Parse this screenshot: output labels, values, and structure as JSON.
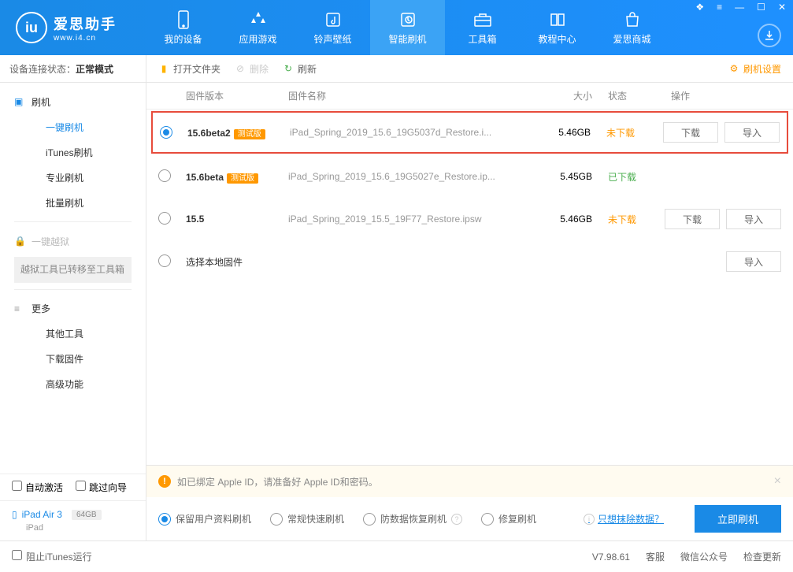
{
  "logo": {
    "cn": "爱思助手",
    "en": "www.i4.cn"
  },
  "nav": [
    {
      "label": "我的设备"
    },
    {
      "label": "应用游戏"
    },
    {
      "label": "铃声壁纸"
    },
    {
      "label": "智能刷机"
    },
    {
      "label": "工具箱"
    },
    {
      "label": "教程中心"
    },
    {
      "label": "爱思商城"
    }
  ],
  "status": {
    "label": "设备连接状态：",
    "value": "正常模式"
  },
  "sidebar": {
    "flash_group": "刷机",
    "items": [
      "一键刷机",
      "iTunes刷机",
      "专业刷机",
      "批量刷机"
    ],
    "jailbreak": "一键越狱",
    "jailbreak_note": "越狱工具已转移至工具箱",
    "more": "更多",
    "more_items": [
      "其他工具",
      "下载固件",
      "高级功能"
    ]
  },
  "checkboxes": {
    "auto_activate": "自动激活",
    "skip_guide": "跳过向导"
  },
  "device": {
    "name": "iPad Air 3",
    "storage": "64GB",
    "type": "iPad"
  },
  "toolbar": {
    "open": "打开文件夹",
    "delete": "删除",
    "refresh": "刷新",
    "settings": "刷机设置"
  },
  "table": {
    "headers": {
      "version": "固件版本",
      "name": "固件名称",
      "size": "大小",
      "status": "状态",
      "ops": "操作"
    },
    "rows": [
      {
        "selected": true,
        "highlighted": true,
        "version": "15.6beta2",
        "beta": "测试版",
        "name": "iPad_Spring_2019_15.6_19G5037d_Restore.i...",
        "size": "5.46GB",
        "status": "未下载",
        "status_cls": "not",
        "ops": true
      },
      {
        "selected": false,
        "version": "15.6beta",
        "beta": "测试版",
        "name": "iPad_Spring_2019_15.6_19G5027e_Restore.ip...",
        "size": "5.45GB",
        "status": "已下载",
        "status_cls": "done",
        "ops": false
      },
      {
        "selected": false,
        "version": "15.5",
        "beta": "",
        "name": "iPad_Spring_2019_15.5_19F77_Restore.ipsw",
        "size": "5.46GB",
        "status": "未下载",
        "status_cls": "not",
        "ops": true
      },
      {
        "selected": false,
        "version": "",
        "beta": "",
        "name_direct": "选择本地固件",
        "size": "",
        "status": "",
        "import_only": true
      }
    ]
  },
  "buttons": {
    "download": "下载",
    "import": "导入"
  },
  "alert": "如已绑定 Apple ID，请准备好 Apple ID和密码。",
  "options": {
    "keep_data": "保留用户资料刷机",
    "quick": "常规快速刷机",
    "recovery": "防数据恢复刷机",
    "repair": "修复刷机",
    "erase_link": "只想抹除数据？",
    "flash": "立即刷机"
  },
  "footer": {
    "block_itunes": "阻止iTunes运行",
    "version": "V7.98.61",
    "support": "客服",
    "wechat": "微信公众号",
    "update": "检查更新"
  }
}
